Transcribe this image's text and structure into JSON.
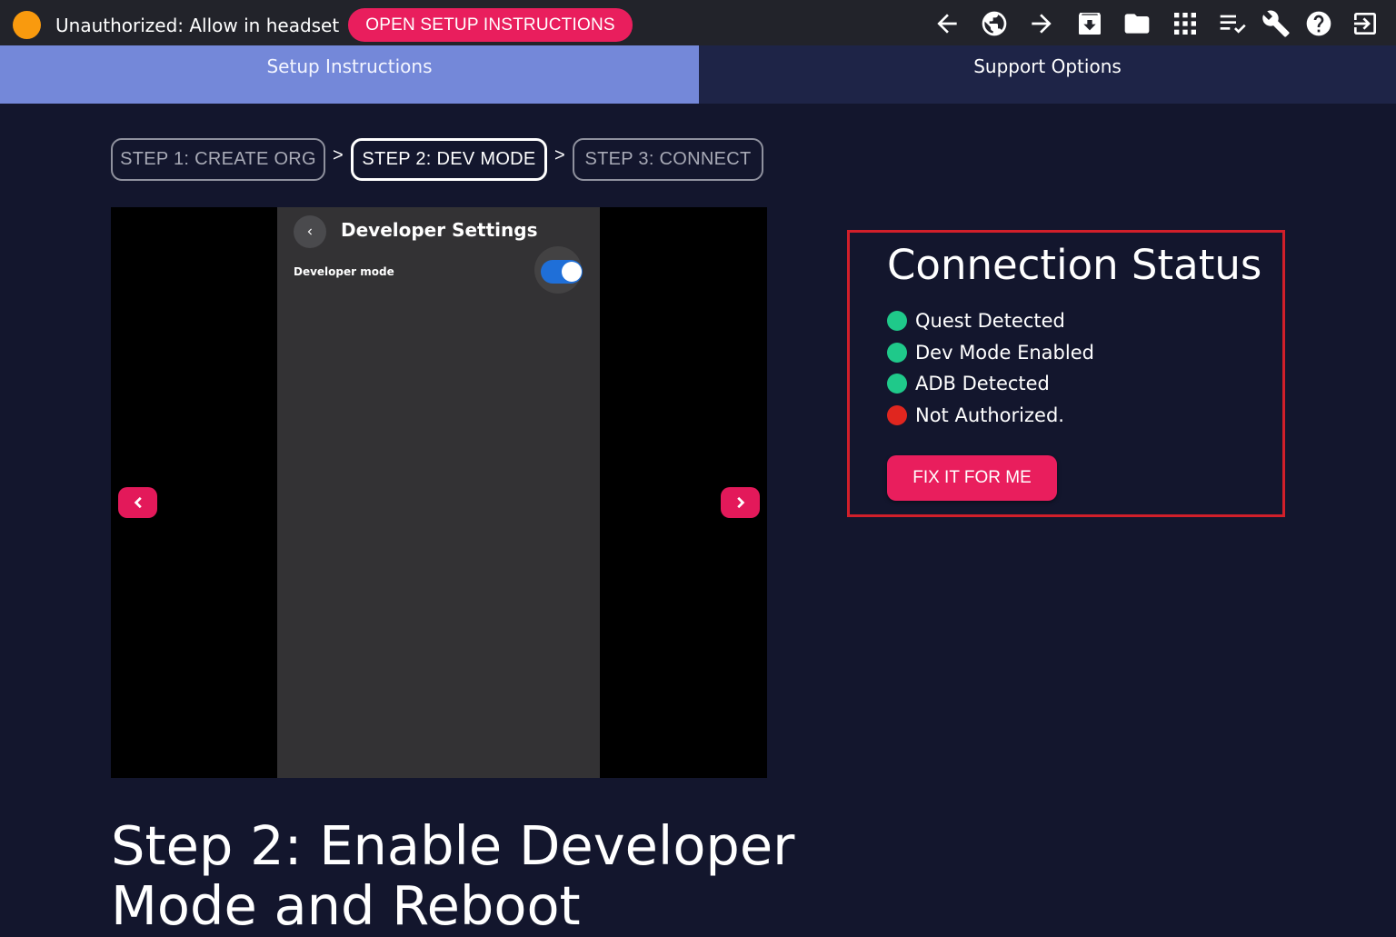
{
  "topbar": {
    "status_color": "#f99a0e",
    "status_text": "Unauthorized: Allow in headset",
    "setup_button_label": "OPEN SETUP INSTRUCTIONS",
    "icons": [
      "arrow-left-icon",
      "globe-icon",
      "arrow-right-icon",
      "archive-download-icon",
      "folder-icon",
      "apps-grid-icon",
      "playlist-check-icon",
      "wrench-icon",
      "help-icon",
      "exit-icon"
    ]
  },
  "tabs": [
    {
      "label": "Setup Instructions",
      "active": true
    },
    {
      "label": "Support Options",
      "active": false
    }
  ],
  "steps": [
    {
      "label": "STEP 1: CREATE ORG",
      "active": false
    },
    {
      "label": "STEP 2: DEV MODE",
      "active": true
    },
    {
      "label": "STEP 3: CONNECT",
      "active": false
    }
  ],
  "step_separator": ">",
  "carousel": {
    "phone_title": "Developer Settings",
    "setting_label": "Developer mode",
    "setting_enabled": true
  },
  "step_heading": "Step 2: Enable Developer Mode and Reboot",
  "connection": {
    "title": "Connection Status",
    "items": [
      {
        "label": "Quest Detected",
        "status": "ok",
        "color": "#1fc98a"
      },
      {
        "label": "Dev Mode Enabled",
        "status": "ok",
        "color": "#1fc98a"
      },
      {
        "label": "ADB Detected",
        "status": "ok",
        "color": "#1fc98a"
      },
      {
        "label": "Not Authorized.",
        "status": "error",
        "color": "#e0261f"
      }
    ],
    "fix_button_label": "FIX IT FOR ME"
  },
  "colors": {
    "accent": "#e91e5d",
    "background": "#13162d",
    "tab_active": "#7488d9",
    "tab_inactive": "#1e2447",
    "highlight_border": "#d11f2a"
  }
}
